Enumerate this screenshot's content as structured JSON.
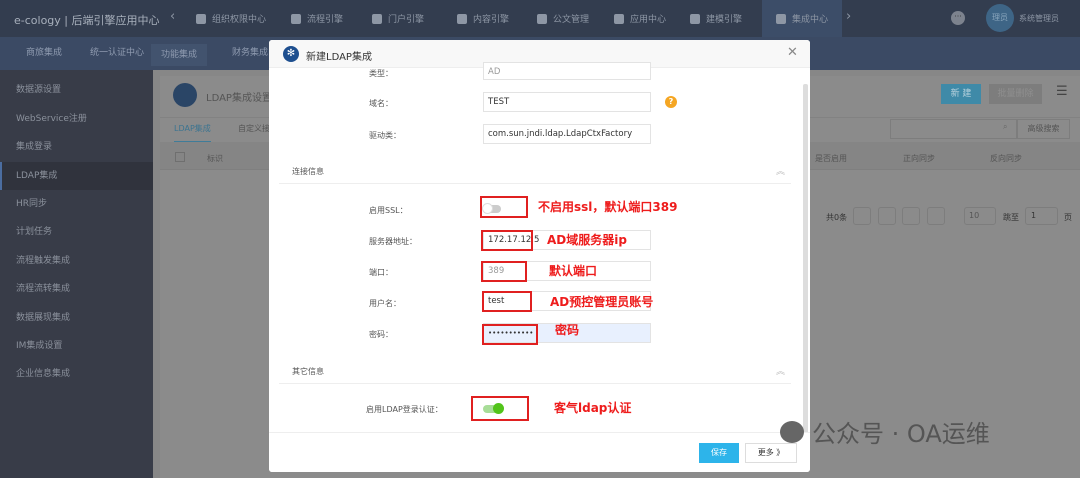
{
  "topbar": {
    "brand": "e-cology | 后端引擎应用中心",
    "nav": [
      "组织权限中心",
      "流程引擎",
      "门户引擎",
      "内容引擎",
      "公文管理",
      "应用中心",
      "建模引擎",
      "集成中心"
    ],
    "active": "集成中心",
    "avatar": "理员",
    "user": "系统管理员"
  },
  "subnav": [
    "商旅集成",
    "统一认证中心",
    "功能集成",
    "财务集成"
  ],
  "sidebar": {
    "items": [
      "数据源设置",
      "WebService注册",
      "集成登录",
      "LDAP集成",
      "HR同步",
      "计划任务",
      "流程触发集成",
      "流程流转集成",
      "数据展现集成",
      "IM集成设置",
      "企业信息集成"
    ],
    "active": "LDAP集成"
  },
  "main": {
    "title": "LDAP集成设置",
    "tabs": [
      "LDAP集成",
      "自定义接"
    ],
    "new_btn": "新 建",
    "batch_delete": "批量删除",
    "adv_search": "高级搜索",
    "columns": [
      "标识",
      "是否启用",
      "正向同步",
      "反向同步"
    ],
    "total": "共0条",
    "page_size": "10",
    "jump_label": "跳至",
    "page": "1",
    "page_unit": "页"
  },
  "modal": {
    "title": "新建LDAP集成",
    "fields": {
      "type_label": "类型：",
      "type_value": "AD",
      "domain_label": "域名：",
      "domain_value": "TEST",
      "driver_label": "驱动类：",
      "driver_value": "com.sun.jndi.ldap.LdapCtxFactory"
    },
    "section_conn": "连接信息",
    "conn": {
      "ssl_label": "启用SSL：",
      "ssl_enabled": false,
      "server_label": "服务器地址：",
      "server_value": "172.17.12.5",
      "port_label": "端口：",
      "port_placeholder": "389",
      "user_label": "用户名：",
      "user_value": "test",
      "pwd_label": "密码：",
      "pwd_value": "•••••••••••"
    },
    "section_other": "其它信息",
    "other": {
      "ldap_login_label": "启用LDAP登录认证：",
      "ldap_login_enabled": true
    },
    "save": "保存",
    "more": "更多 》"
  },
  "annotations": [
    "不启用ssl，默认端口389",
    "AD域服务器ip",
    "默认端口",
    "AD预控管理员账号",
    "密码",
    "客气ldap认证"
  ],
  "watermark": "公众号 · OA运维",
  "colors": {
    "accent": "#2db4ea",
    "annotation": "#ee1c1c",
    "toggle_on": "#52c41a"
  }
}
